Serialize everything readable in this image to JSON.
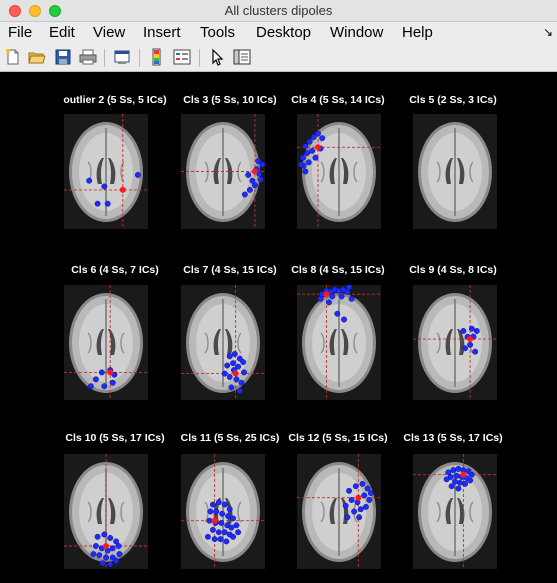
{
  "window": {
    "title": "All clusters dipoles"
  },
  "menu": {
    "items": [
      "File",
      "Edit",
      "View",
      "Insert",
      "Tools",
      "Desktop",
      "Window",
      "Help"
    ],
    "overflow": "↘"
  },
  "toolbar": {
    "icons": [
      "new-figure-icon",
      "open-file-icon",
      "save-icon",
      "print-icon",
      "print-preview-icon",
      "colorbar-icon",
      "legend-icon",
      "pointer-icon",
      "property-editor-icon"
    ]
  },
  "panels": [
    {
      "title": "outlier 2 (5 Ss, 5 ICs)",
      "cross": [
        0.7,
        0.66
      ],
      "dots": [
        [
          0.3,
          0.58
        ],
        [
          0.48,
          0.63
        ],
        [
          0.88,
          0.53
        ],
        [
          0.4,
          0.78
        ],
        [
          0.52,
          0.78
        ]
      ]
    },
    {
      "title": "Cls 3 (5 Ss, 10 ICs)",
      "cross": [
        0.88,
        0.5
      ],
      "dots": [
        [
          0.8,
          0.53
        ],
        [
          0.9,
          0.48
        ],
        [
          0.95,
          0.57
        ],
        [
          0.85,
          0.58
        ],
        [
          0.92,
          0.41
        ],
        [
          0.97,
          0.44
        ],
        [
          0.82,
          0.66
        ],
        [
          0.88,
          0.62
        ],
        [
          0.76,
          0.7
        ],
        [
          0.93,
          0.52
        ]
      ]
    },
    {
      "title": "Cls 4 (5 Ss, 14 ICs)",
      "cross": [
        0.25,
        0.29
      ],
      "dots": [
        [
          0.1,
          0.28
        ],
        [
          0.15,
          0.24
        ],
        [
          0.2,
          0.2
        ],
        [
          0.25,
          0.17
        ],
        [
          0.3,
          0.21
        ],
        [
          0.07,
          0.38
        ],
        [
          0.12,
          0.34
        ],
        [
          0.18,
          0.32
        ],
        [
          0.08,
          0.45
        ],
        [
          0.14,
          0.42
        ],
        [
          0.22,
          0.38
        ],
        [
          0.28,
          0.3
        ],
        [
          0.1,
          0.5
        ],
        [
          0.05,
          0.44
        ]
      ]
    },
    {
      "title": "Cls 5 (2 Ss, 3 ICs)",
      "cross": null,
      "dots": []
    },
    {
      "title": "Cls 6 (4 Ss, 7 ICs)",
      "cross": [
        0.55,
        0.76
      ],
      "dots": [
        [
          0.45,
          0.76
        ],
        [
          0.55,
          0.74
        ],
        [
          0.6,
          0.78
        ],
        [
          0.38,
          0.82
        ],
        [
          0.48,
          0.88
        ],
        [
          0.32,
          0.88
        ],
        [
          0.58,
          0.85
        ]
      ]
    },
    {
      "title": "Cls 7 (4 Ss, 15 ICs)",
      "cross": [
        0.65,
        0.77
      ],
      "dots": [
        [
          0.58,
          0.62
        ],
        [
          0.64,
          0.6
        ],
        [
          0.7,
          0.64
        ],
        [
          0.55,
          0.7
        ],
        [
          0.62,
          0.68
        ],
        [
          0.68,
          0.71
        ],
        [
          0.74,
          0.67
        ],
        [
          0.52,
          0.77
        ],
        [
          0.58,
          0.8
        ],
        [
          0.66,
          0.82
        ],
        [
          0.72,
          0.85
        ],
        [
          0.6,
          0.89
        ],
        [
          0.7,
          0.92
        ],
        [
          0.75,
          0.76
        ],
        [
          0.63,
          0.74
        ]
      ]
    },
    {
      "title": "Cls 8 (4 Ss, 15 ICs)",
      "cross": [
        0.35,
        0.08
      ],
      "dots": [
        [
          0.3,
          0.08
        ],
        [
          0.35,
          0.05
        ],
        [
          0.4,
          0.06
        ],
        [
          0.45,
          0.04
        ],
        [
          0.5,
          0.05
        ],
        [
          0.55,
          0.04
        ],
        [
          0.6,
          0.06
        ],
        [
          0.28,
          0.12
        ],
        [
          0.42,
          0.1
        ],
        [
          0.53,
          0.1
        ],
        [
          0.62,
          0.02
        ],
        [
          0.48,
          0.25
        ],
        [
          0.56,
          0.3
        ],
        [
          0.38,
          0.15
        ],
        [
          0.65,
          0.12
        ]
      ]
    },
    {
      "title": "Cls 9 (4 Ss, 8 ICs)",
      "cross": [
        0.68,
        0.47
      ],
      "dots": [
        [
          0.6,
          0.4
        ],
        [
          0.65,
          0.45
        ],
        [
          0.72,
          0.45
        ],
        [
          0.68,
          0.52
        ],
        [
          0.74,
          0.58
        ],
        [
          0.62,
          0.55
        ],
        [
          0.76,
          0.4
        ],
        [
          0.7,
          0.38
        ]
      ]
    },
    {
      "title": "Cls 10 (5 Ss, 17 ICs)",
      "cross": [
        0.5,
        0.8
      ],
      "dots": [
        [
          0.4,
          0.72
        ],
        [
          0.48,
          0.7
        ],
        [
          0.55,
          0.73
        ],
        [
          0.62,
          0.76
        ],
        [
          0.38,
          0.8
        ],
        [
          0.45,
          0.82
        ],
        [
          0.52,
          0.84
        ],
        [
          0.58,
          0.82
        ],
        [
          0.65,
          0.8
        ],
        [
          0.42,
          0.88
        ],
        [
          0.5,
          0.9
        ],
        [
          0.58,
          0.9
        ],
        [
          0.66,
          0.87
        ],
        [
          0.46,
          0.95
        ],
        [
          0.55,
          0.96
        ],
        [
          0.35,
          0.87
        ],
        [
          0.62,
          0.93
        ]
      ]
    },
    {
      "title": "Cls 11 (5 Ss, 25 ICs)",
      "cross": [
        0.4,
        0.58
      ],
      "dots": [
        [
          0.38,
          0.44
        ],
        [
          0.45,
          0.42
        ],
        [
          0.52,
          0.44
        ],
        [
          0.58,
          0.48
        ],
        [
          0.35,
          0.5
        ],
        [
          0.42,
          0.5
        ],
        [
          0.49,
          0.52
        ],
        [
          0.56,
          0.54
        ],
        [
          0.62,
          0.56
        ],
        [
          0.34,
          0.58
        ],
        [
          0.41,
          0.6
        ],
        [
          0.48,
          0.6
        ],
        [
          0.55,
          0.62
        ],
        [
          0.6,
          0.64
        ],
        [
          0.66,
          0.62
        ],
        [
          0.38,
          0.66
        ],
        [
          0.45,
          0.68
        ],
        [
          0.52,
          0.68
        ],
        [
          0.58,
          0.7
        ],
        [
          0.32,
          0.72
        ],
        [
          0.4,
          0.74
        ],
        [
          0.47,
          0.74
        ],
        [
          0.54,
          0.76
        ],
        [
          0.62,
          0.72
        ],
        [
          0.68,
          0.68
        ]
      ]
    },
    {
      "title": "Cls 12 (5 Ss, 15 ICs)",
      "cross": [
        0.73,
        0.38
      ],
      "dots": [
        [
          0.62,
          0.32
        ],
        [
          0.7,
          0.28
        ],
        [
          0.78,
          0.26
        ],
        [
          0.84,
          0.3
        ],
        [
          0.65,
          0.4
        ],
        [
          0.72,
          0.42
        ],
        [
          0.8,
          0.36
        ],
        [
          0.86,
          0.4
        ],
        [
          0.58,
          0.45
        ],
        [
          0.68,
          0.5
        ],
        [
          0.76,
          0.48
        ],
        [
          0.82,
          0.46
        ],
        [
          0.6,
          0.55
        ],
        [
          0.74,
          0.55
        ],
        [
          0.88,
          0.34
        ]
      ]
    },
    {
      "title": "Cls 13 (5 Ss, 17 ICs)",
      "cross": [
        0.6,
        0.18
      ],
      "dots": [
        [
          0.42,
          0.16
        ],
        [
          0.48,
          0.14
        ],
        [
          0.54,
          0.13
        ],
        [
          0.6,
          0.14
        ],
        [
          0.66,
          0.15
        ],
        [
          0.7,
          0.18
        ],
        [
          0.45,
          0.2
        ],
        [
          0.52,
          0.19
        ],
        [
          0.58,
          0.2
        ],
        [
          0.64,
          0.21
        ],
        [
          0.5,
          0.24
        ],
        [
          0.56,
          0.25
        ],
        [
          0.62,
          0.26
        ],
        [
          0.4,
          0.22
        ],
        [
          0.68,
          0.23
        ],
        [
          0.46,
          0.28
        ],
        [
          0.54,
          0.3
        ]
      ]
    }
  ]
}
